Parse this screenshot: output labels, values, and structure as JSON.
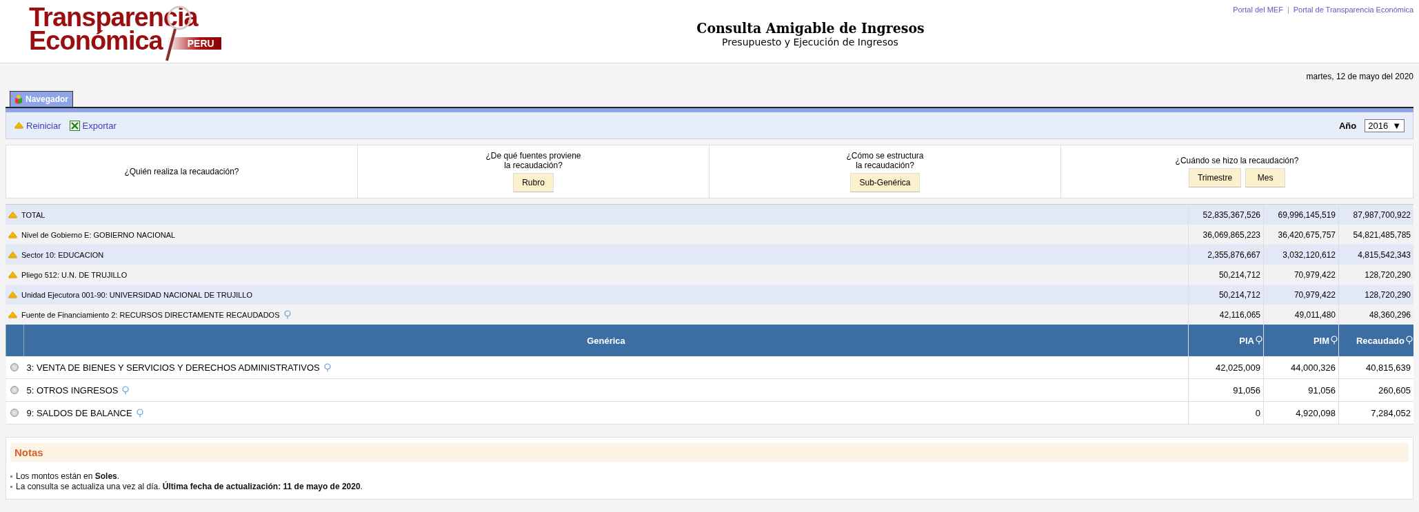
{
  "header": {
    "logo": {
      "line1": "Transparencia",
      "line2": "Económica",
      "badge": "PERU"
    },
    "top_links": [
      "Portal del MEF",
      "Portal de Transparencia Económica"
    ],
    "link_separator": "|",
    "title": "Consulta Amigable de Ingresos",
    "subtitle": "Presupuesto y Ejecución de Ingresos"
  },
  "date": "martes, 12 de mayo del 2020",
  "tabs": [
    {
      "label": "Navegador",
      "selected": true
    }
  ],
  "toolbar": {
    "reset": "Reiniciar",
    "export": "Exportar",
    "year": {
      "label": "Año",
      "value": "2016",
      "caret": "▼"
    }
  },
  "questions": [
    {
      "text": "¿Quién realiza la recaudación?"
    },
    {
      "text": "¿De qué fuentes proviene\nla recaudación?",
      "buttons": [
        "Rubro"
      ]
    },
    {
      "text": "¿Cómo se estructura\nla recaudación?",
      "buttons": [
        "Sub-Genérica"
      ]
    },
    {
      "text": "¿Cuándo se hizo la recaudación?",
      "buttons": [
        "Trimestre",
        "Mes"
      ]
    }
  ],
  "breadcrumbs": [
    {
      "label": "TOTAL",
      "pin": false,
      "values": [
        "52,835,367,526",
        "69,996,145,519",
        "87,987,700,922"
      ]
    },
    {
      "label": "Nivel de Gobierno E: GOBIERNO NACIONAL",
      "pin": false,
      "values": [
        "36,069,865,223",
        "36,420,675,757",
        "54,821,485,785"
      ]
    },
    {
      "label": "Sector 10: EDUCACION",
      "pin": false,
      "values": [
        "2,355,876,667",
        "3,032,120,612",
        "4,815,542,343"
      ]
    },
    {
      "label": "Pliego 512: U.N. DE TRUJILLO",
      "pin": false,
      "values": [
        "50,214,712",
        "70,979,422",
        "128,720,290"
      ]
    },
    {
      "label": "Unidad Ejecutora 001-90: UNIVERSIDAD NACIONAL DE TRUJILLO",
      "pin": false,
      "values": [
        "50,214,712",
        "70,979,422",
        "128,720,290"
      ]
    },
    {
      "label": "Fuente de Financiamiento 2: RECURSOS DIRECTAMENTE RECAUDADOS",
      "pin": true,
      "values": [
        "42,116,065",
        "49,011,480",
        "48,360,296"
      ]
    }
  ],
  "table": {
    "columns": [
      {
        "label": "Genérica",
        "pin": false
      },
      {
        "label": "PIA",
        "pin": true
      },
      {
        "label": "PIM",
        "pin": true
      },
      {
        "label": "Recaudado",
        "pin": true
      }
    ],
    "rows": [
      {
        "label": "3: VENTA DE BIENES Y SERVICIOS Y DERECHOS ADMINISTRATIVOS",
        "pin": true,
        "selected": false,
        "values": [
          "42,025,009",
          "44,000,326",
          "40,815,639"
        ]
      },
      {
        "label": "5: OTROS INGRESOS",
        "pin": true,
        "selected": false,
        "values": [
          "91,056",
          "91,056",
          "260,605"
        ]
      },
      {
        "label": "9: SALDOS DE BALANCE",
        "pin": true,
        "selected": false,
        "values": [
          "0",
          "4,920,098",
          "7,284,052"
        ]
      }
    ]
  },
  "notes": {
    "title": "Notas",
    "items": [
      "Los montos están en **Soles**.",
      "La consulta se actualiza una vez al día. **Última fecha de actualización: 11 de mayo de 2020**."
    ]
  }
}
